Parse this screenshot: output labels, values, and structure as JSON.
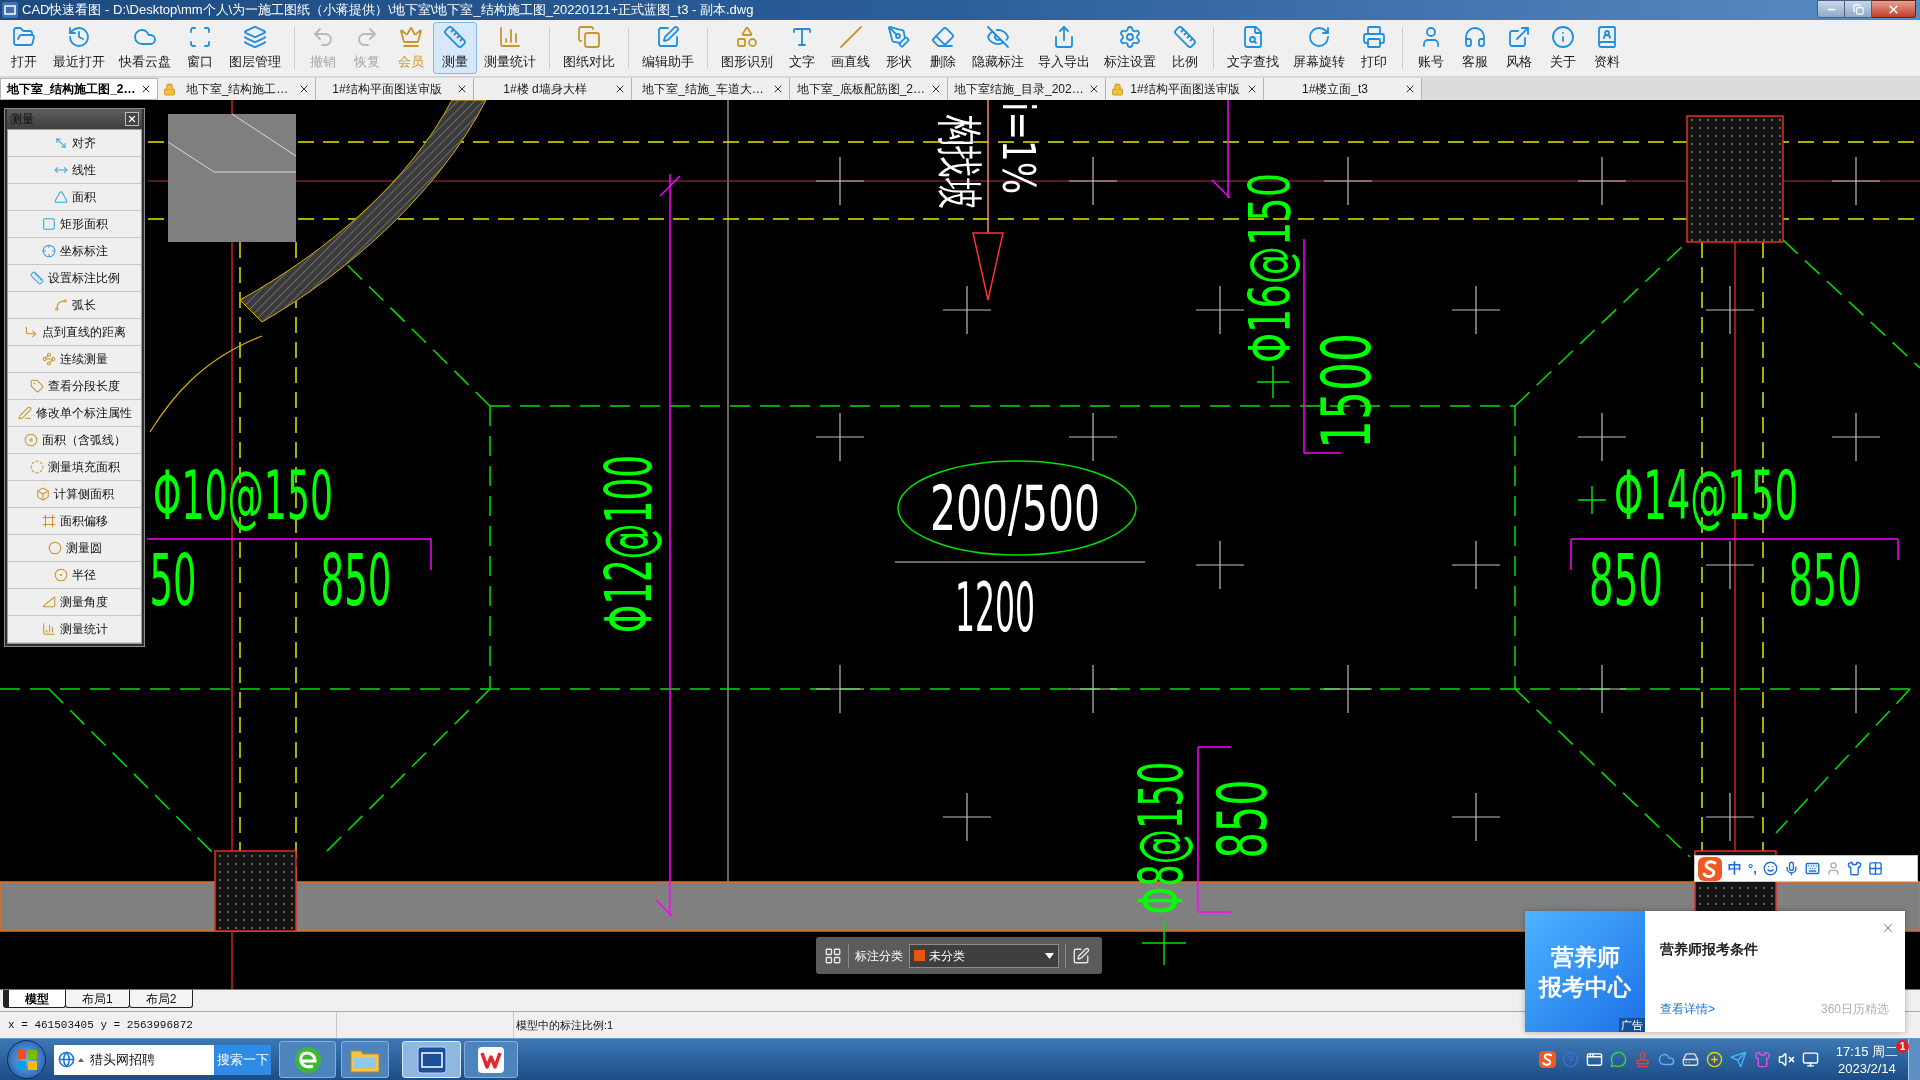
{
  "window": {
    "title": "CAD快速看图 - D:\\Desktop\\mm个人\\为一施工图纸（小蒋提供）\\地下室\\地下室_结构施工图_20220121+正式蓝图_t3 - 副本.dwg"
  },
  "toolbar": {
    "groups": [
      [
        {
          "label": "打开",
          "kind": "normal",
          "selected": false,
          "disabled": false
        },
        {
          "label": "最近打开",
          "kind": "normal",
          "selected": false,
          "disabled": false
        },
        {
          "label": "快看云盘",
          "kind": "normal",
          "selected": false,
          "disabled": false
        },
        {
          "label": "窗口",
          "kind": "normal",
          "selected": false,
          "disabled": false
        },
        {
          "label": "图层管理",
          "kind": "normal",
          "selected": false,
          "disabled": false
        }
      ],
      [
        {
          "label": "撤销",
          "kind": "normal",
          "selected": false,
          "disabled": true
        },
        {
          "label": "恢复",
          "kind": "normal",
          "selected": false,
          "disabled": true
        },
        {
          "label": "会员",
          "kind": "vip",
          "selected": false,
          "disabled": false
        },
        {
          "label": "测量",
          "kind": "normal",
          "selected": true,
          "disabled": false
        },
        {
          "label": "测量统计",
          "kind": "normal",
          "selected": false,
          "disabled": false
        }
      ],
      [
        {
          "label": "图纸对比",
          "kind": "normal",
          "selected": false,
          "disabled": false
        }
      ],
      [
        {
          "label": "编辑助手",
          "kind": "normal",
          "selected": false,
          "disabled": false
        }
      ],
      [
        {
          "label": "图形识别",
          "kind": "normal",
          "selected": false,
          "disabled": false
        },
        {
          "label": "文字",
          "kind": "normal",
          "selected": false,
          "disabled": false
        },
        {
          "label": "画直线",
          "kind": "normal",
          "selected": false,
          "disabled": false
        },
        {
          "label": "形状",
          "kind": "normal",
          "selected": false,
          "disabled": false
        },
        {
          "label": "删除",
          "kind": "normal",
          "selected": false,
          "disabled": false
        },
        {
          "label": "隐藏标注",
          "kind": "normal",
          "selected": false,
          "disabled": false
        },
        {
          "label": "导入导出",
          "kind": "normal",
          "selected": false,
          "disabled": false
        },
        {
          "label": "标注设置",
          "kind": "normal",
          "selected": false,
          "disabled": false
        },
        {
          "label": "比例",
          "kind": "normal",
          "selected": false,
          "disabled": false
        }
      ],
      [
        {
          "label": "文字查找",
          "kind": "normal",
          "selected": false,
          "disabled": false
        },
        {
          "label": "屏幕旋转",
          "kind": "normal",
          "selected": false,
          "disabled": false
        },
        {
          "label": "打印",
          "kind": "normal",
          "selected": false,
          "disabled": false
        }
      ],
      [
        {
          "label": "账号",
          "kind": "normal",
          "selected": false,
          "disabled": false
        },
        {
          "label": "客服",
          "kind": "normal",
          "selected": false,
          "disabled": false
        },
        {
          "label": "风格",
          "kind": "normal",
          "selected": false,
          "disabled": false
        },
        {
          "label": "关于",
          "kind": "normal",
          "selected": false,
          "disabled": false
        },
        {
          "label": "资料",
          "kind": "normal",
          "selected": false,
          "disabled": false
        }
      ]
    ]
  },
  "tabs": [
    {
      "label": "地下室_结构施工图_2…",
      "selected": true,
      "locked": false
    },
    {
      "label": "地下室_结构施工…",
      "selected": false,
      "locked": true
    },
    {
      "label": "1#结构平面图送审版",
      "selected": false,
      "locked": false
    },
    {
      "label": "1#楼 d墙身大样",
      "selected": false,
      "locked": false
    },
    {
      "label": "地下室_结施_车道大…",
      "selected": false,
      "locked": false
    },
    {
      "label": "地下室_底板配筋图_2…",
      "selected": false,
      "locked": false
    },
    {
      "label": "地下室结施_目录_202…",
      "selected": false,
      "locked": false
    },
    {
      "label": "1#结构平面图送审版",
      "selected": false,
      "locked": true
    },
    {
      "label": "1#楼立面_t3",
      "selected": false,
      "locked": false
    }
  ],
  "measure_panel": {
    "title": "测量",
    "items": [
      "对齐",
      "线性",
      "面积",
      "矩形面积",
      "坐标标注",
      "设置标注比例",
      "弧长",
      "点到直线的距离",
      "连续测量",
      "查看分段长度",
      "修改单个标注属性",
      "面积（含弧线）",
      "测量填充面积",
      "计算侧面积",
      "面积偏移",
      "测量圆",
      "半径",
      "测量角度",
      "测量统计"
    ]
  },
  "canvas": {
    "labels": [
      {
        "text": "构找坡",
        "color": "#ffffff"
      },
      {
        "text": "i=1%",
        "color": "#ffffff"
      },
      {
        "text": "Φ16@150",
        "color": "#00ff00"
      },
      {
        "text": "1500",
        "color": "#00ff00"
      },
      {
        "text": "Φ10@150",
        "color": "#00ff00"
      },
      {
        "text": "50",
        "color": "#00ff00"
      },
      {
        "text": "850",
        "color": "#00ff00"
      },
      {
        "text": "Φ12@100",
        "color": "#00ff00"
      },
      {
        "text": "200/500",
        "color": "#ffffff"
      },
      {
        "text": "1200",
        "color": "#ffffff"
      },
      {
        "text": "Φ14@150",
        "color": "#00ff00"
      },
      {
        "text": "850",
        "color": "#00ff00"
      },
      {
        "text": "850",
        "color": "#00ff00"
      },
      {
        "text": "Φ8@150",
        "color": "#00ff00"
      },
      {
        "text": "850",
        "color": "#00ff00"
      }
    ]
  },
  "annotation_toolbar": {
    "label": "标注分类",
    "category": {
      "value": "未分类",
      "color": "#e8560c"
    }
  },
  "ime_bar": {
    "mode": "中",
    "punctuation": "°,"
  },
  "layout_tabs": [
    {
      "label": "模型",
      "selected": true
    },
    {
      "label": "布局1",
      "selected": false
    },
    {
      "label": "布局2",
      "selected": false
    }
  ],
  "status_bar": {
    "coordinates": "x = 461503405 y = 2563996872",
    "scale": "模型中的标注比例:1"
  },
  "notification": {
    "banner": [
      "营养师",
      "报考中心"
    ],
    "banner_tag": "广告",
    "title": "营养师报考条件",
    "link": "查看详情>",
    "source": "360日历精选"
  },
  "taskbar": {
    "search": {
      "value": "猎头网招聘",
      "button": "搜索一下"
    },
    "apps": [
      {
        "selected": false
      },
      {
        "selected": false
      },
      {
        "selected": true
      },
      {
        "selected": false
      }
    ],
    "clock": {
      "time": "17:15 周二",
      "date": "2023/2/14",
      "badge": "1"
    }
  }
}
